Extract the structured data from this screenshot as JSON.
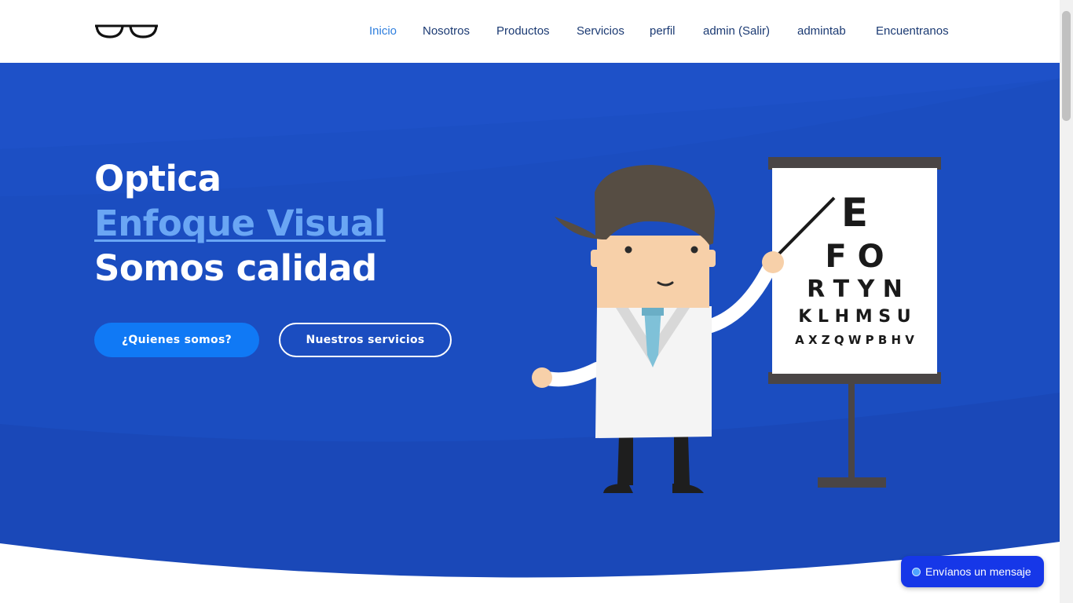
{
  "nav": {
    "items": [
      {
        "label": "Inicio",
        "active": true
      },
      {
        "label": "Nosotros"
      },
      {
        "label": "Productos"
      },
      {
        "label": "Servicios"
      },
      {
        "label": "perfil"
      },
      {
        "label": "admin (Salir)"
      },
      {
        "label": "admintab"
      },
      {
        "label": "Encuentranos"
      }
    ]
  },
  "hero": {
    "line1": "Optica",
    "line2": "Enfoque Visual",
    "line3": "Somos calidad",
    "primary_button": "¿Quienes somos?",
    "secondary_button": "Nuestros servicios"
  },
  "eye_chart": {
    "rows": [
      "E",
      "F O",
      "R T Y N",
      "K L H M S U",
      "A X Z Q W P B H V"
    ]
  },
  "chat": {
    "label": "Envíanos un mensaje"
  },
  "colors": {
    "hero_bg": "#1c4fc4",
    "nav_text": "#1b3a73",
    "nav_active": "#2f7fde",
    "brand_highlight": "#6aa6f4",
    "primary_button": "#1079f5",
    "chat_button": "#1637e8"
  },
  "icons": {
    "logo": "glasses-icon"
  }
}
